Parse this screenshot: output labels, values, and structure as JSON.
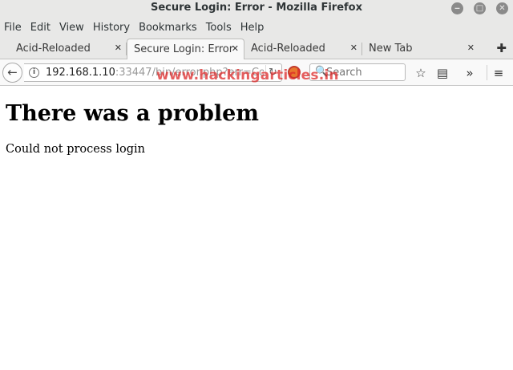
{
  "window": {
    "title": "Secure Login: Error - Mozilla Firefox",
    "minimize_glyph": "‒",
    "maximize_glyph": "□",
    "close_glyph": "✕"
  },
  "menu": {
    "items": [
      "File",
      "Edit",
      "View",
      "History",
      "Bookmarks",
      "Tools",
      "Help"
    ]
  },
  "tabs": [
    {
      "label": "Acid-Reloaded",
      "close": "✕"
    },
    {
      "label": "Secure Login: Error",
      "close": "✕",
      "active": true
    },
    {
      "label": "Acid-Reloaded",
      "close": "✕"
    },
    {
      "label": "New Tab",
      "close": "✕"
    }
  ],
  "newtab_glyph": "✚",
  "navbar": {
    "back_glyph": "←",
    "info_glyph": "i",
    "url_host": "192.168.1.10",
    "url_rest": ":33447/bin/error.php?err=Cou",
    "reload_glyph": "↻",
    "search_placeholder": "Search",
    "search_glyph": "🔍",
    "bookmark_glyph": "☆",
    "reader_glyph": "▤",
    "overflow_glyph": "»",
    "menu_glyph": "≡"
  },
  "watermark": "www.hackingarticles.in",
  "page": {
    "heading": "There was a problem",
    "message": "Could not process login"
  },
  "colors": {
    "chrome_bg": "#e8e8e7",
    "navbar_bg": "#f9f9f9",
    "watermark": "#dc2828"
  }
}
